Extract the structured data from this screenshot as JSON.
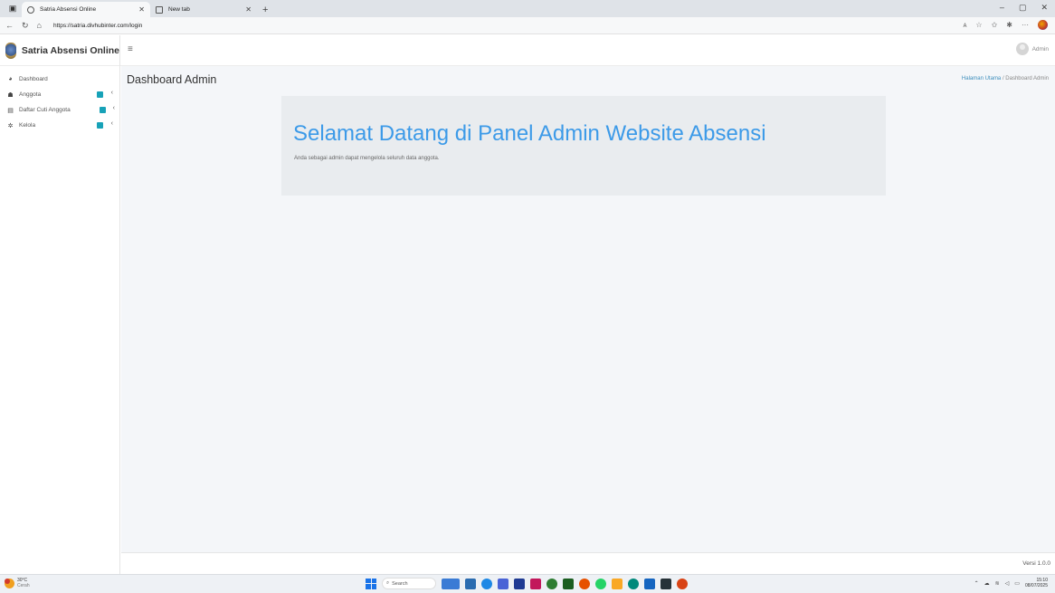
{
  "browser": {
    "tabs": [
      {
        "title": "Satria Absensi Online",
        "active": true
      },
      {
        "title": "New tab",
        "active": false
      }
    ],
    "new_tab": "+",
    "url": "https://satria.divhubinter.com/login",
    "window_controls": {
      "minimize": "–",
      "restore": "▢",
      "close": "✕"
    }
  },
  "app": {
    "brand": "Satria Absensi Online",
    "menu": [
      {
        "label": "Dashboard",
        "icon": "dashboard-icon"
      },
      {
        "label": "Anggota",
        "icon": "users-icon"
      },
      {
        "label": "Daftar Cuti Anggota",
        "icon": "calendar-icon"
      },
      {
        "label": "Kelola",
        "icon": "gear-icon"
      }
    ],
    "topnav": {
      "user": "Admin"
    },
    "page_title": "Dashboard Admin",
    "breadcrumb": {
      "home": "Halaman Utama",
      "sep": "/",
      "current": "Dashboard Admin"
    },
    "jumbotron": {
      "heading": "Selamat Datang di Panel Admin Website Absensi",
      "text": "Anda sebagai admin dapat mengelola seluruh data anggota."
    },
    "footer": {
      "version": "Versi 1.0.0"
    }
  },
  "taskbar": {
    "weather": {
      "temp": "30°C",
      "desc": "Cerah"
    },
    "search_placeholder": "Search",
    "clock": {
      "time": "15:10",
      "date": "08/07/2025"
    }
  },
  "colors": {
    "accent": "#3c9ae8",
    "badge": "#17a2b8",
    "content_bg": "#f4f6f9",
    "jumbotron_bg": "#e9ecef"
  }
}
